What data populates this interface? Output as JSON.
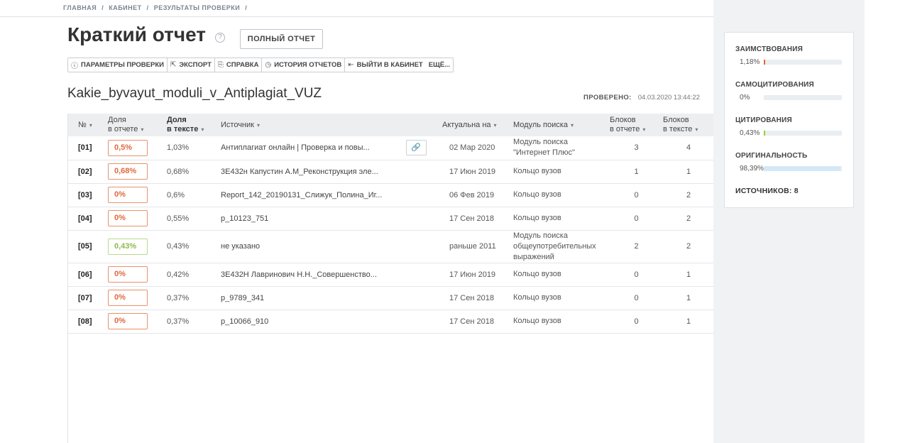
{
  "breadcrumb": [
    "ГЛАВНАЯ",
    "/",
    "КАБИНЕТ",
    "/",
    "РЕЗУЛЬТАТЫ ПРОВЕРКИ",
    "/"
  ],
  "page_title": "Краткий отчет",
  "help_glyph": "?",
  "full_report_label": "ПОЛНЫЙ ОТЧЕТ",
  "toolbar": [
    {
      "icon": "info-icon",
      "glyph": "ⓘ",
      "label": "ПАРАМЕТРЫ ПРОВЕРКИ"
    },
    {
      "icon": "export-icon",
      "glyph": "⇱",
      "label": "ЭКСПОРТ"
    },
    {
      "icon": "help-book-icon",
      "glyph": "⎘",
      "label": "СПРАВКА"
    },
    {
      "icon": "history-icon",
      "glyph": "◷",
      "label": "ИСТОРИЯ ОТЧЕТОВ"
    },
    {
      "icon": "exit-icon",
      "glyph": "⇤",
      "label": "ВЫЙТИ В КАБИНЕТ"
    },
    {
      "icon": "",
      "glyph": "",
      "label": "ЕЩЁ..."
    }
  ],
  "document_name": "Kakie_byvayut_moduli_v_Antiplagiat_VUZ",
  "checked_label": "ПРОВЕРЕНО:",
  "checked_value": "04.03.2020 13:44:22",
  "table": {
    "headers": {
      "num": "№",
      "share_report_1": "Доля",
      "share_report_2": "в отчете",
      "share_text_1": "Доля",
      "share_text_2": "в тексте",
      "source": "Источник",
      "actual": "Актуальна на",
      "module": "Модуль поиска",
      "blocks_report_1": "Блоков",
      "blocks_report_2": "в отчете",
      "blocks_text_1": "Блоков",
      "blocks_text_2": "в тексте"
    },
    "rows": [
      {
        "num": "[01]",
        "share_report": "0,5%",
        "share_text": "1,03%",
        "source": "Антиплагиат онлайн | Проверка и повы...",
        "date": "02 Мар 2020",
        "module": "Модуль поиска \"Интернет Плюс\"",
        "blocks_report": "3",
        "blocks_text": "4"
      },
      {
        "num": "[02]",
        "share_report": "0,68%",
        "share_text": "0,68%",
        "source": "3E432н Капустин А.М_Реконструкция эле...",
        "date": "17 Июн 2019",
        "module": "Кольцо вузов",
        "blocks_report": "1",
        "blocks_text": "1"
      },
      {
        "num": "[03]",
        "share_report": "0%",
        "share_text": "0,6%",
        "source": "Report_142_20190131_Слижук_Полина_Иг...",
        "date": "06 Фев 2019",
        "module": "Кольцо вузов",
        "blocks_report": "0",
        "blocks_text": "2"
      },
      {
        "num": "[04]",
        "share_report": "0%",
        "share_text": "0,55%",
        "source": "p_10123_751",
        "date": "17 Сен 2018",
        "module": "Кольцо вузов",
        "blocks_report": "0",
        "blocks_text": "2"
      },
      {
        "num": "[05]",
        "share_report": "0,43%",
        "share_text": "0,43%",
        "source": "не указано",
        "date": "раньше 2011",
        "module": "Модуль поиска общеупотребительных выражений",
        "blocks_report": "2",
        "blocks_text": "2"
      },
      {
        "num": "[06]",
        "share_report": "0%",
        "share_text": "0,42%",
        "source": "3E432Н Лавринович Н.Н._Совершенство...",
        "date": "17 Июн 2019",
        "module": "Кольцо вузов",
        "blocks_report": "0",
        "blocks_text": "1"
      },
      {
        "num": "[07]",
        "share_report": "0%",
        "share_text": "0,37%",
        "source": "p_9789_341",
        "date": "17 Сен 2018",
        "module": "Кольцо вузов",
        "blocks_report": "0",
        "blocks_text": "1"
      },
      {
        "num": "[08]",
        "share_report": "0%",
        "share_text": "0,37%",
        "source": "p_10066_910",
        "date": "17 Сен 2018",
        "module": "Кольцо вузов",
        "blocks_report": "0",
        "blocks_text": "1"
      }
    ]
  },
  "stats": [
    {
      "label": "ЗАИМСТВОВАНИЯ",
      "value": "1,18%",
      "fraction": 0.0118,
      "color": "#e8662f"
    },
    {
      "label": "САМОЦИТИРОВАНИЯ",
      "value": "0%",
      "fraction": 0,
      "color": "#f0b400"
    },
    {
      "label": "ЦИТИРОВАНИЯ",
      "value": "0,43%",
      "fraction": 0.0043,
      "color": "#9acd32"
    },
    {
      "label": "ОРИГИНАЛЬНОСТЬ",
      "value": "98,39%",
      "fraction": 0.9839,
      "color": "#d4e8f7"
    }
  ],
  "sources_label": "ИСТОЧНИКОВ:",
  "sources_count": "8",
  "colors": {
    "accent_orange": "#e2683e",
    "accent_green": "#8dbb4c",
    "sidebar_bg": "#f0f2f4"
  }
}
